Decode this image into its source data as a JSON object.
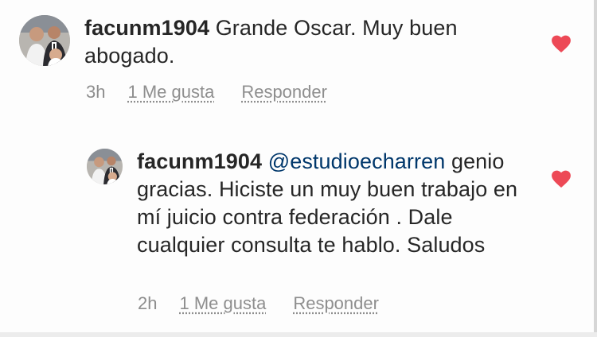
{
  "colors": {
    "heart": "#ed4956",
    "username": "#262626",
    "mention": "#00376b",
    "meta": "#8e8e8e"
  },
  "comments": [
    {
      "username": "facunm1904",
      "mention": "",
      "text": "Grande Oscar. Muy buen abogado.",
      "time": "3h",
      "likes": "1 Me gusta",
      "reply": "Responder",
      "liked": true,
      "avatar": "avatar"
    },
    {
      "username": "facunm1904",
      "mention": "@estudioecharren",
      "text": "genio gracias. Hiciste un muy buen trabajo en mí juicio contra federación . Dale cualquier consulta te hablo. Saludos",
      "time": "2h",
      "likes": "1 Me gusta",
      "reply": "Responder",
      "liked": true,
      "avatar": "avatar"
    }
  ]
}
